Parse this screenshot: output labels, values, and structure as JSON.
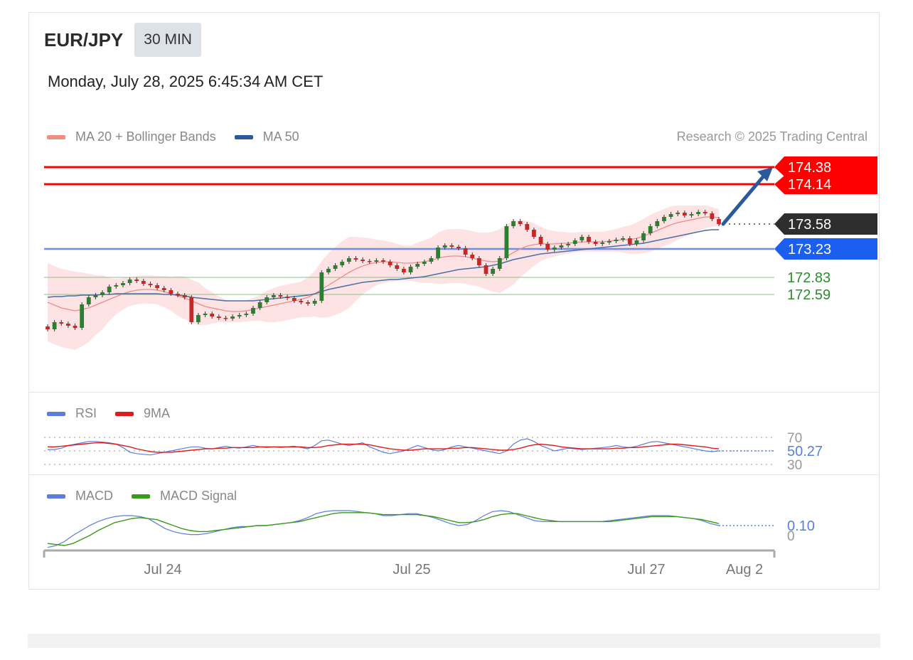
{
  "header": {
    "symbol": "EUR/JPY",
    "timeframe": "30 MIN",
    "datetime": "Monday, July 28, 2025 6:45:34 AM CET",
    "copyright": "Research © 2025 Trading Central"
  },
  "legend_main": [
    {
      "label": "MA 20 + Bollinger Bands",
      "color": "#f28b82"
    },
    {
      "label": "MA 50",
      "color": "#2a5a9a"
    }
  ],
  "legend_rsi": [
    {
      "label": "RSI",
      "color": "#5b7fd8"
    },
    {
      "label": "9MA",
      "color": "#e01b1b"
    }
  ],
  "legend_macd": [
    {
      "label": "MACD",
      "color": "#5b7fd8"
    },
    {
      "label": "MACD Signal",
      "color": "#3a9a1a"
    }
  ],
  "colors": {
    "resistance": "#ff0000",
    "support": "#1a5ff0",
    "current": "#2e2e2e",
    "target_green": "#2e8b2e",
    "candle_up": "#2e7d32",
    "candle_down": "#c62828",
    "band_fill": "#fde3e3",
    "arrow": "#2a5a9a"
  },
  "chart_data": [
    {
      "type": "candlestick",
      "title": "EUR/JPY 30 MIN",
      "x_ticks": [
        "Jul 24",
        "Jul 25",
        "Jul 27",
        "Aug 2"
      ],
      "ylim": [
        172.0,
        174.5
      ],
      "price_levels": [
        {
          "value": 174.38,
          "label": "174.38",
          "kind": "resistance"
        },
        {
          "value": 174.14,
          "label": "174.14",
          "kind": "resistance"
        },
        {
          "value": 173.58,
          "label": "173.58",
          "kind": "current"
        },
        {
          "value": 173.23,
          "label": "173.23",
          "kind": "support"
        },
        {
          "value": 172.83,
          "label": "172.83",
          "kind": "target"
        },
        {
          "value": 172.59,
          "label": "172.59",
          "kind": "target"
        }
      ],
      "close_series": [
        172.1,
        172.2,
        172.18,
        172.15,
        172.12,
        172.45,
        172.55,
        172.58,
        172.62,
        172.7,
        172.72,
        172.75,
        172.8,
        172.78,
        172.74,
        172.72,
        172.68,
        172.65,
        172.6,
        172.58,
        172.55,
        172.2,
        172.3,
        172.32,
        172.28,
        172.26,
        172.25,
        172.28,
        172.3,
        172.32,
        172.4,
        172.48,
        172.55,
        172.58,
        172.56,
        172.54,
        172.5,
        172.48,
        172.46,
        172.5,
        172.9,
        172.95,
        173.0,
        173.05,
        173.1,
        173.08,
        173.06,
        173.05,
        173.07,
        173.05,
        173.0,
        172.95,
        172.9,
        172.98,
        173.02,
        173.05,
        173.1,
        173.25,
        173.28,
        173.26,
        173.24,
        173.15,
        173.1,
        173.0,
        172.88,
        172.95,
        173.1,
        173.55,
        173.62,
        173.58,
        173.5,
        173.4,
        173.3,
        173.22,
        173.25,
        173.28,
        173.3,
        173.35,
        173.4,
        173.33,
        173.3,
        173.32,
        173.34,
        173.36,
        173.38,
        173.3,
        173.35,
        173.45,
        173.55,
        173.62,
        173.68,
        173.72,
        173.74,
        173.7,
        173.72,
        173.75,
        173.73,
        173.65,
        173.58
      ],
      "ma20": [
        172.48,
        172.44,
        172.4,
        172.38,
        172.36,
        172.38,
        172.4,
        172.44,
        172.48,
        172.52,
        172.56,
        172.6,
        172.63,
        172.65,
        172.66,
        172.66,
        172.65,
        172.63,
        172.6,
        172.57,
        172.54,
        172.5,
        172.46,
        172.42,
        172.4,
        172.38,
        172.36,
        172.35,
        172.35,
        172.36,
        172.38,
        172.4,
        172.42,
        172.44,
        172.46,
        172.48,
        172.5,
        172.52,
        172.55,
        172.6,
        172.66,
        172.72,
        172.78,
        172.84,
        172.9,
        172.95,
        172.99,
        173.02,
        173.04,
        173.05,
        173.05,
        173.04,
        173.03,
        173.03,
        173.04,
        173.05,
        173.07,
        173.1,
        173.12,
        173.13,
        173.13,
        173.12,
        173.1,
        173.08,
        173.06,
        173.05,
        173.06,
        173.12,
        173.18,
        173.23,
        173.27,
        173.29,
        173.3,
        173.3,
        173.3,
        173.31,
        173.31,
        173.32,
        173.33,
        173.33,
        173.33,
        173.33,
        173.34,
        173.35,
        173.36,
        173.36,
        173.38,
        173.41,
        173.45,
        173.49,
        173.53,
        173.57,
        173.6,
        173.62,
        173.64,
        173.66,
        173.68,
        173.68,
        173.67
      ],
      "ma50": [
        172.55,
        172.56,
        172.56,
        172.57,
        172.57,
        172.58,
        172.58,
        172.58,
        172.59,
        172.59,
        172.6,
        172.6,
        172.6,
        172.6,
        172.6,
        172.6,
        172.6,
        172.59,
        172.59,
        172.58,
        172.57,
        172.55,
        172.54,
        172.53,
        172.52,
        172.51,
        172.5,
        172.5,
        172.5,
        172.5,
        172.5,
        172.51,
        172.52,
        172.53,
        172.54,
        172.55,
        172.56,
        172.57,
        172.58,
        172.6,
        172.63,
        172.66,
        172.68,
        172.7,
        172.72,
        172.74,
        172.76,
        172.77,
        172.78,
        172.79,
        172.8,
        172.8,
        172.81,
        172.82,
        172.83,
        172.84,
        172.86,
        172.88,
        172.9,
        172.92,
        172.94,
        172.95,
        172.96,
        172.97,
        172.98,
        173.0,
        173.02,
        173.05,
        173.08,
        173.1,
        173.12,
        173.14,
        173.16,
        173.17,
        173.18,
        173.19,
        173.2,
        173.21,
        173.22,
        173.23,
        173.24,
        173.25,
        173.26,
        173.27,
        173.28,
        173.29,
        173.3,
        173.31,
        173.33,
        173.35,
        173.37,
        173.39,
        173.41,
        173.43,
        173.45,
        173.47,
        173.49,
        173.5,
        173.5
      ],
      "bb_width": [
        0.55,
        0.55,
        0.55,
        0.55,
        0.55,
        0.52,
        0.48,
        0.42,
        0.38,
        0.3,
        0.25,
        0.22,
        0.2,
        0.2,
        0.2,
        0.2,
        0.2,
        0.22,
        0.24,
        0.28,
        0.3,
        0.3,
        0.3,
        0.26,
        0.22,
        0.18,
        0.16,
        0.15,
        0.15,
        0.15,
        0.16,
        0.18,
        0.22,
        0.24,
        0.25,
        0.25,
        0.25,
        0.25,
        0.28,
        0.32,
        0.4,
        0.45,
        0.48,
        0.5,
        0.5,
        0.45,
        0.4,
        0.36,
        0.32,
        0.3,
        0.28,
        0.26,
        0.25,
        0.25,
        0.28,
        0.3,
        0.32,
        0.36,
        0.38,
        0.38,
        0.38,
        0.38,
        0.38,
        0.38,
        0.4,
        0.42,
        0.45,
        0.45,
        0.45,
        0.4,
        0.36,
        0.3,
        0.24,
        0.2,
        0.18,
        0.16,
        0.15,
        0.14,
        0.14,
        0.14,
        0.14,
        0.14,
        0.15,
        0.16,
        0.18,
        0.2,
        0.22,
        0.24,
        0.26,
        0.26,
        0.26,
        0.26,
        0.24,
        0.22,
        0.2,
        0.18,
        0.16,
        0.14,
        0.12
      ],
      "forecast": {
        "from": 173.58,
        "to": 174.38
      }
    },
    {
      "type": "line",
      "title": "RSI",
      "current_value": "50.27",
      "reference_levels": [
        70,
        30
      ],
      "ylim": [
        25,
        75
      ],
      "series": [
        {
          "name": "RSI",
          "values": [
            52,
            52,
            54,
            58,
            60,
            62,
            64,
            64,
            63,
            62,
            60,
            55,
            48,
            46,
            45,
            44,
            46,
            48,
            50,
            52,
            54,
            56,
            56,
            54,
            53,
            55,
            57,
            55,
            54,
            56,
            58,
            56,
            55,
            56,
            55,
            56,
            57,
            55,
            53,
            58,
            65,
            66,
            63,
            60,
            58,
            60,
            62,
            56,
            52,
            48,
            46,
            48,
            50,
            54,
            58,
            55,
            52,
            50,
            52,
            56,
            58,
            56,
            54,
            52,
            50,
            48,
            46,
            50,
            60,
            66,
            68,
            64,
            58,
            54,
            50,
            52,
            54,
            53,
            52,
            53,
            54,
            55,
            56,
            58,
            56,
            55,
            57,
            60,
            63,
            64,
            62,
            60,
            58,
            56,
            54,
            52,
            50,
            49,
            50
          ]
        },
        {
          "name": "9MA",
          "values": [
            56,
            56,
            57,
            58,
            59,
            60,
            61,
            62,
            62,
            61,
            60,
            58,
            56,
            53,
            51,
            49,
            48,
            48,
            48,
            49,
            50,
            51,
            52,
            53,
            53,
            54,
            54,
            55,
            55,
            55,
            55,
            56,
            56,
            56,
            56,
            56,
            56,
            56,
            55,
            55,
            56,
            58,
            59,
            60,
            60,
            60,
            60,
            59,
            57,
            55,
            53,
            52,
            51,
            51,
            52,
            53,
            53,
            53,
            53,
            54,
            54,
            55,
            55,
            54,
            53,
            52,
            51,
            51,
            52,
            54,
            57,
            59,
            60,
            59,
            58,
            56,
            55,
            54,
            53,
            53,
            53,
            53,
            53,
            54,
            54,
            55,
            55,
            56,
            57,
            58,
            59,
            60,
            60,
            59,
            58,
            57,
            56,
            54,
            53
          ]
        }
      ]
    },
    {
      "type": "line",
      "title": "MACD",
      "current_value": "0.10",
      "zero_label": "0",
      "ylim": [
        -0.2,
        0.4
      ],
      "series": [
        {
          "name": "MACD",
          "values": [
            -0.12,
            -0.1,
            -0.06,
            0.0,
            0.05,
            0.1,
            0.14,
            0.17,
            0.19,
            0.2,
            0.2,
            0.19,
            0.17,
            0.12,
            0.07,
            0.04,
            0.02,
            0.01,
            0.01,
            0.02,
            0.04,
            0.06,
            0.08,
            0.09,
            0.09,
            0.1,
            0.1,
            0.11,
            0.12,
            0.13,
            0.15,
            0.18,
            0.22,
            0.24,
            0.25,
            0.25,
            0.25,
            0.24,
            0.23,
            0.22,
            0.2,
            0.2,
            0.21,
            0.22,
            0.22,
            0.2,
            0.18,
            0.15,
            0.12,
            0.1,
            0.11,
            0.15,
            0.2,
            0.24,
            0.25,
            0.24,
            0.21,
            0.18,
            0.15,
            0.14,
            0.14,
            0.14,
            0.14,
            0.14,
            0.14,
            0.14,
            0.14,
            0.15,
            0.16,
            0.17,
            0.18,
            0.19,
            0.2,
            0.2,
            0.2,
            0.19,
            0.18,
            0.17,
            0.15,
            0.12,
            0.1
          ]
        },
        {
          "name": "MACD Signal",
          "values": [
            -0.08,
            -0.09,
            -0.1,
            -0.08,
            -0.04,
            0.0,
            0.05,
            0.09,
            0.13,
            0.15,
            0.17,
            0.18,
            0.17,
            0.16,
            0.13,
            0.1,
            0.07,
            0.05,
            0.04,
            0.04,
            0.05,
            0.06,
            0.07,
            0.08,
            0.09,
            0.1,
            0.1,
            0.11,
            0.12,
            0.13,
            0.14,
            0.16,
            0.18,
            0.2,
            0.22,
            0.23,
            0.23,
            0.23,
            0.23,
            0.22,
            0.21,
            0.21,
            0.21,
            0.21,
            0.21,
            0.2,
            0.19,
            0.17,
            0.15,
            0.13,
            0.13,
            0.14,
            0.16,
            0.19,
            0.21,
            0.22,
            0.22,
            0.2,
            0.18,
            0.16,
            0.15,
            0.14,
            0.14,
            0.14,
            0.14,
            0.14,
            0.14,
            0.14,
            0.15,
            0.16,
            0.17,
            0.18,
            0.19,
            0.19,
            0.19,
            0.19,
            0.18,
            0.17,
            0.16,
            0.14,
            0.12
          ]
        }
      ]
    }
  ]
}
